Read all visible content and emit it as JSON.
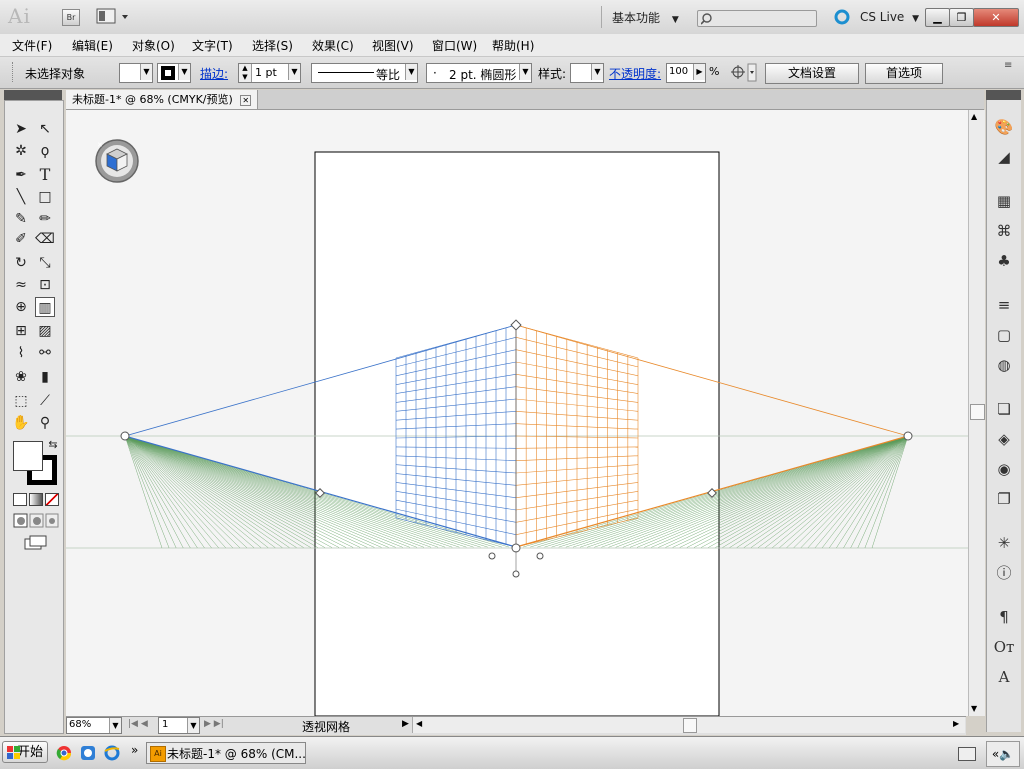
{
  "app": {
    "logo": "Ai",
    "bridge_label": "Br",
    "workspace": "基本功能",
    "search_placeholder": "",
    "cs_live": "CS Live",
    "win_min": "▁",
    "win_max": "❐",
    "win_close": "✕"
  },
  "menu": [
    "文件(F)",
    "编辑(E)",
    "对象(O)",
    "文字(T)",
    "选择(S)",
    "效果(C)",
    "视图(V)",
    "窗口(W)",
    "帮助(H)"
  ],
  "control": {
    "selection_label": "未选择对象",
    "stroke_label": "描边:",
    "stroke_value": "1 pt",
    "stroke_style": "等比",
    "brush": "2 pt. 椭圆形",
    "brush_dot": "·",
    "style_label": "样式:",
    "opacity_label": "不透明度:",
    "opacity_value": "100",
    "opacity_unit": "%",
    "doc_settings": "文档设置",
    "preferences": "首选项"
  },
  "document": {
    "tab_title": "未标题-1* @ 68% (CMYK/预览)",
    "tab_close": "✕"
  },
  "tools": {
    "selection": "➤",
    "direct": "↖",
    "magic": "✲",
    "lasso": "ϙ",
    "pen": "✒",
    "type": "T",
    "line": "╲",
    "rect": "□",
    "brush": "✎",
    "pencil": "✏",
    "blob": "✐",
    "eraser": "⌫",
    "rotate": "↻",
    "scale": "⤡",
    "warp": "≈",
    "freetransform": "⊡",
    "shapebuilder": "⊕",
    "perspective": "▥",
    "mesh": "⊞",
    "gradient": "▨",
    "eyedropper": "⌇",
    "blend": "⚯",
    "symbol": "❀",
    "graph": "▮",
    "artboard": "⬚",
    "slice": "⟋",
    "hand": "✋",
    "zoom": "⚲",
    "swap": "⇆"
  },
  "right_panel": [
    "🎨",
    "◢",
    "▦",
    "⌘",
    "♣",
    "≡",
    "▢",
    "◍",
    "❏",
    "◈",
    "◉",
    "❐",
    "✳",
    "ⓘ",
    "¶",
    "Oᴛ",
    "A"
  ],
  "status": {
    "zoom": "68%",
    "artboard": "1",
    "tool_name": "透视网格"
  },
  "taskbar": {
    "start": "开始",
    "window_title": "未标题-1* @ 68% (CM...",
    "chevron": "»"
  },
  "colors": {
    "left_grid": "#3b73c9",
    "right_grid": "#e8892a",
    "ground_grid": "#5a9a5a"
  }
}
